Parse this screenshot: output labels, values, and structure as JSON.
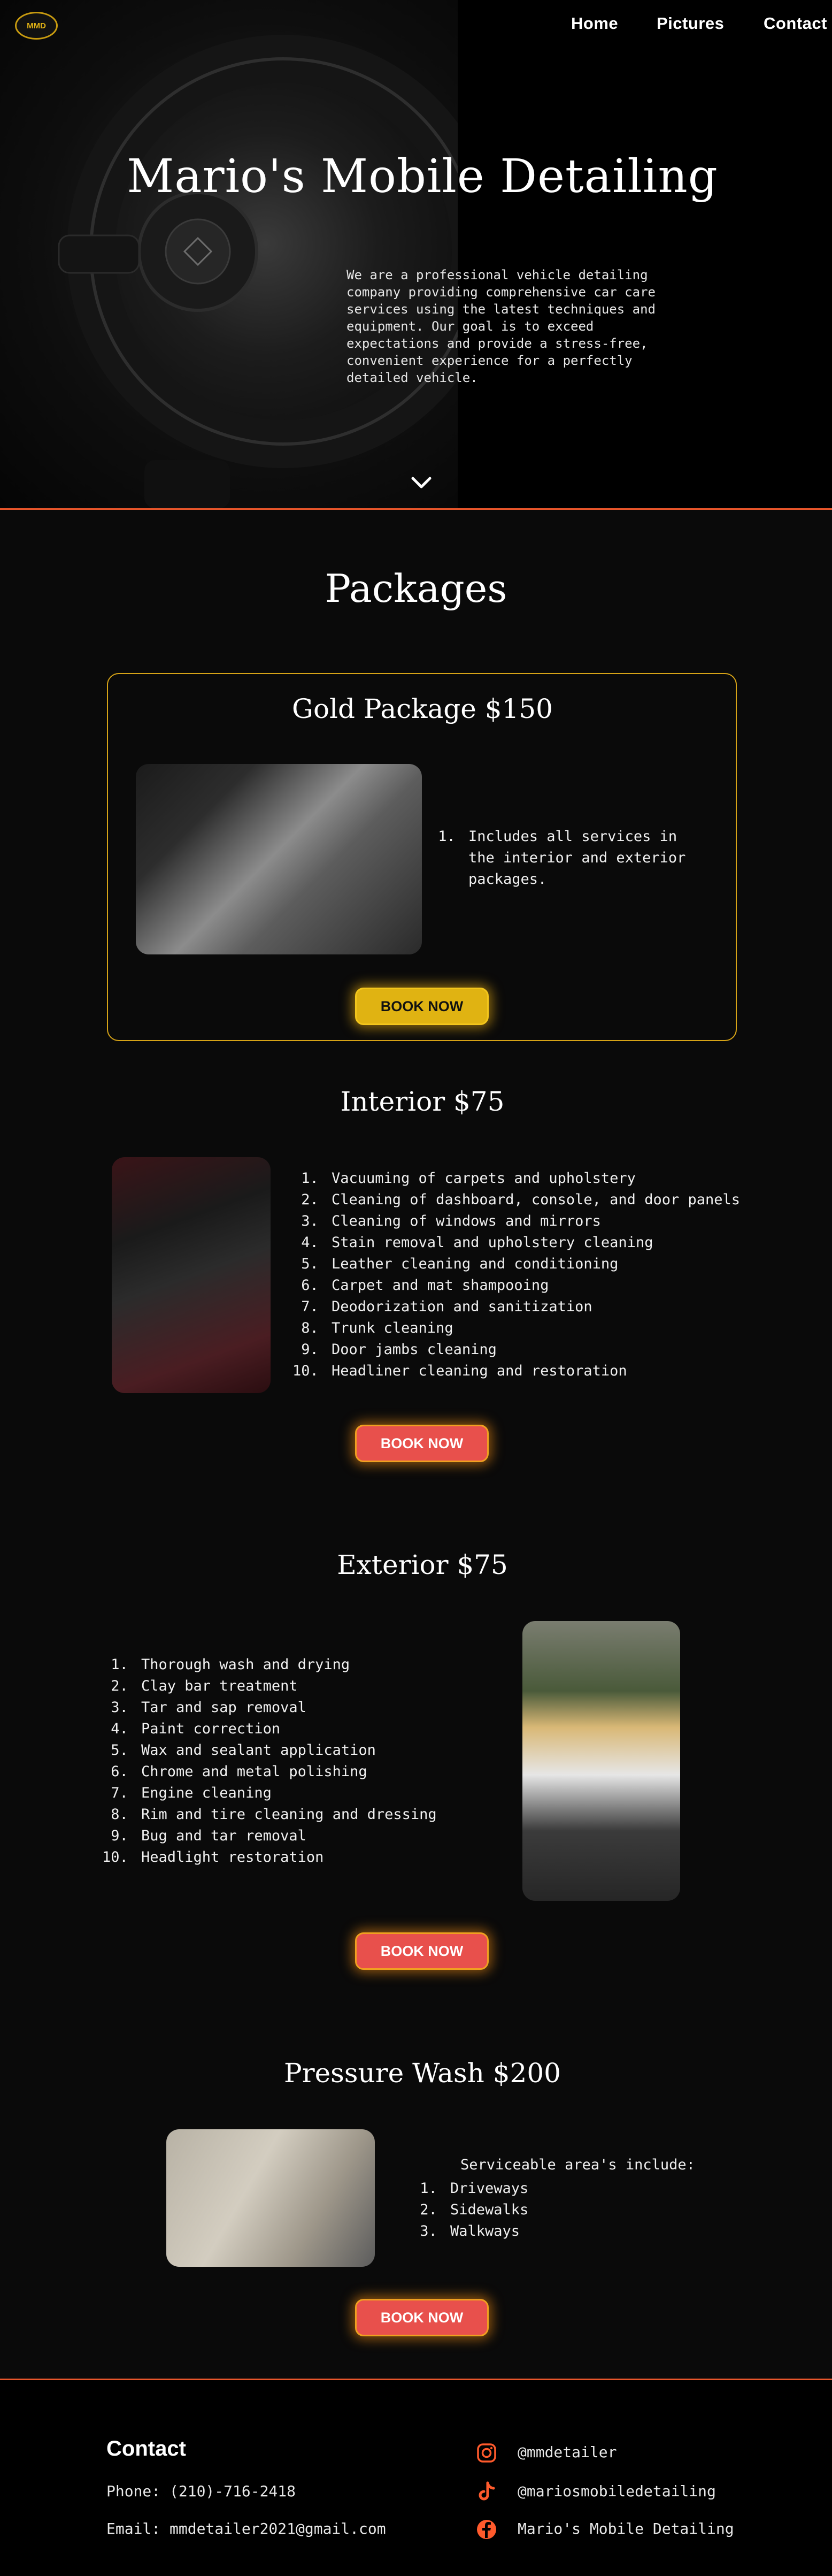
{
  "nav": {
    "logo_text": "MMD",
    "home": "Home",
    "pictures": "Pictures",
    "contact": "Contact"
  },
  "hero": {
    "title": "Mario's Mobile Detailing",
    "text": "We are a professional vehicle detailing company providing comprehensive car care services using the latest techniques and equipment. Our goal is to exceed expectations and provide a stress-free, convenient experience for a perfectly detailed vehicle."
  },
  "packages": {
    "title": "Packages",
    "gold": {
      "title": "Gold Package $150",
      "items": [
        "Includes all services in the interior and exterior packages."
      ],
      "button": "BOOK NOW"
    },
    "interior": {
      "title": "Interior $75",
      "items": [
        "Vacuuming of carpets and upholstery",
        "Cleaning of dashboard, console, and door panels",
        "Cleaning of windows and mirrors",
        "Stain removal and upholstery cleaning",
        "Leather cleaning and conditioning",
        "Carpet and mat shampooing",
        "Deodorization and sanitization",
        "Trunk cleaning",
        "Door jambs cleaning",
        "Headliner cleaning and restoration"
      ],
      "button": "BOOK NOW"
    },
    "exterior": {
      "title": "Exterior $75",
      "items": [
        "Thorough wash and drying",
        "Clay bar treatment",
        "Tar and sap removal",
        "Paint correction",
        "Wax and sealant application",
        "Chrome and metal polishing",
        "Engine cleaning",
        "Rim and tire cleaning and dressing",
        "Bug and tar removal",
        "Headlight restoration"
      ],
      "button": "BOOK NOW"
    },
    "pressure_wash": {
      "title": "Pressure Wash $200",
      "intro": "Serviceable area's include:",
      "items": [
        "Driveways",
        "Sidewalks",
        "Walkways"
      ],
      "button": "BOOK NOW"
    }
  },
  "footer": {
    "heading": "Contact",
    "phone": "Phone: (210)-716-2418",
    "email": "Email: mmdetailer2021@gmail.com",
    "instagram": "@mmdetailer",
    "tiktok": "@mariosmobiledetailing",
    "facebook": "Mario's Mobile Detailing"
  },
  "colors": {
    "accent_orange": "#e8562b",
    "gold": "#e0b312",
    "button_red": "#e8504c"
  },
  "icons": [
    "chevron-down-icon",
    "instagram-icon",
    "tiktok-icon",
    "facebook-icon"
  ]
}
